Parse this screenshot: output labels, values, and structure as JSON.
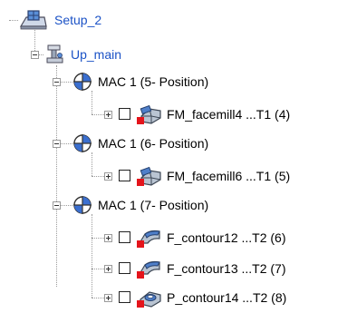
{
  "tree": {
    "setup": {
      "label": "Setup_2",
      "icon": "setup-icon"
    },
    "group": {
      "label": "Up_main",
      "icon": "machine-group-icon"
    },
    "machines": [
      {
        "label": "MAC 1 (5- Position)",
        "icon": "target-icon",
        "operations": [
          {
            "label": "FM_facemill4 ...T1 (4)",
            "icon": "facemill-icon"
          }
        ]
      },
      {
        "label": "MAC 1 (6- Position)",
        "icon": "target-icon",
        "operations": [
          {
            "label": "FM_facemill6 ...T1 (5)",
            "icon": "facemill-icon"
          }
        ]
      },
      {
        "label": "MAC 1 (7- Position)",
        "icon": "target-icon",
        "operations": [
          {
            "label": "F_contour12 ...T2 (6)",
            "icon": "contour-icon"
          },
          {
            "label": "F_contour13 ...T2 (7)",
            "icon": "contour-icon"
          },
          {
            "label": "P_contour14 ...T2 (8)",
            "icon": "pocket-contour-icon"
          }
        ]
      }
    ]
  },
  "colors": {
    "link_blue": "#1b52c6",
    "operation_marker_red": "#e4141b",
    "target_blue": "#3a6fd0"
  }
}
